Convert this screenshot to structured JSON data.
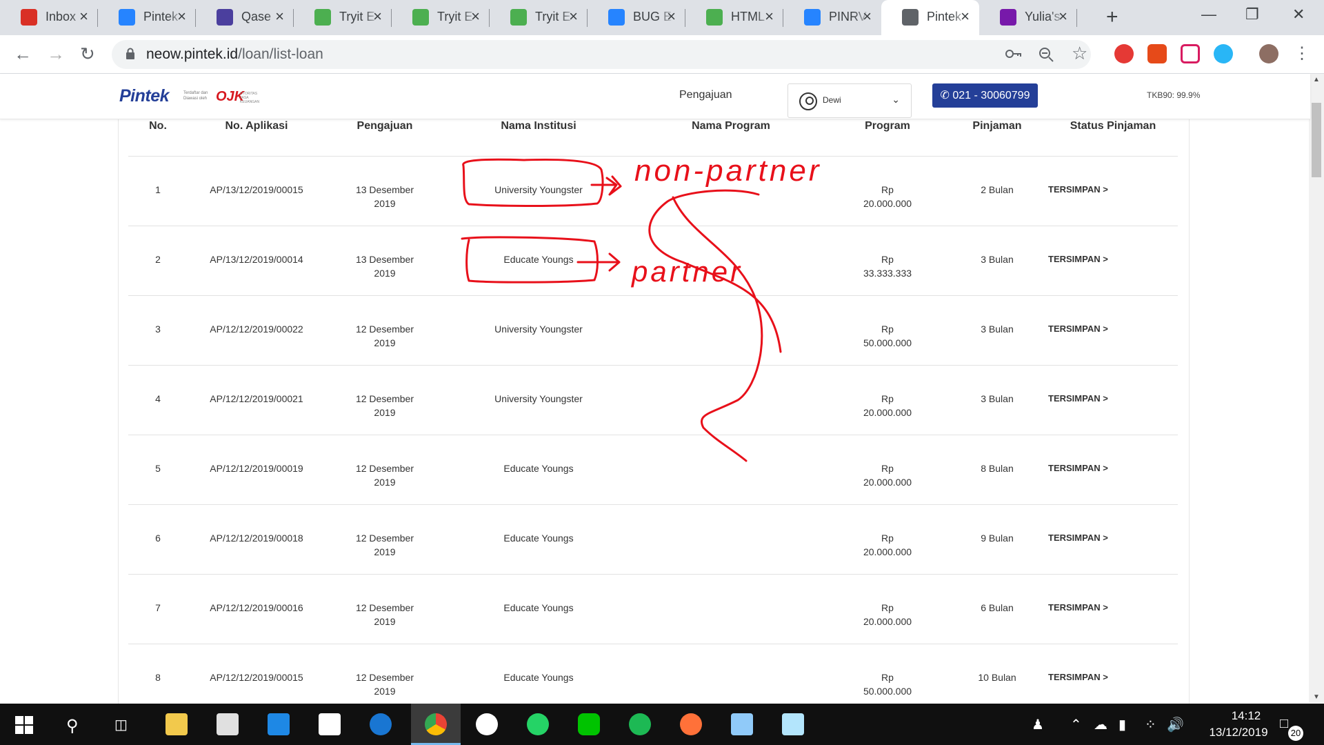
{
  "browser": {
    "tabs": [
      {
        "title": "Inbox",
        "favicon": "gmail-icon",
        "color": "#d93025"
      },
      {
        "title": "Pintek",
        "favicon": "jira-icon",
        "color": "#2684ff"
      },
      {
        "title": "Qase",
        "favicon": "qase-icon",
        "color": "#4b3f9e"
      },
      {
        "title": "Tryit E",
        "favicon": "w3schools-icon",
        "color": "#4caf50"
      },
      {
        "title": "Tryit E",
        "favicon": "w3schools-icon",
        "color": "#4caf50"
      },
      {
        "title": "Tryit E",
        "favicon": "w3schools-icon",
        "color": "#4caf50"
      },
      {
        "title": "BUG E",
        "favicon": "jira-icon",
        "color": "#2684ff"
      },
      {
        "title": "HTML",
        "favicon": "w3schools-icon",
        "color": "#4caf50"
      },
      {
        "title": "PINRV",
        "favicon": "jira-icon",
        "color": "#2684ff"
      },
      {
        "title": "Pintek",
        "favicon": "globe-icon",
        "color": "#5f6368"
      },
      {
        "title": "Yulia's",
        "favicon": "onenote-icon",
        "color": "#7719aa"
      }
    ],
    "active_tab": 9,
    "url_host": "neow.pintek.id",
    "url_path": "/loan/list-loan"
  },
  "header": {
    "logo": "Pintek",
    "ojk_registered": "Terdaftar dan Diawasi oleh",
    "ojk_logo": "OJK",
    "ojk_sub": "OTORITAS JASA KEUANGAN",
    "nav_pengajuan": "Pengajuan",
    "user_name": "Dewi",
    "phone": "021 - 30060799",
    "tkb": "TKB90: 99.9%"
  },
  "table": {
    "columns": [
      "No.",
      "No. Aplikasi",
      "Pengajuan",
      "Nama Institusi",
      "Nama Program",
      "Program",
      "Pinjaman",
      "Status Pinjaman"
    ],
    "rows": [
      {
        "no": "1",
        "app": "AP/13/12/2019/00015",
        "date1": "13 Desember",
        "date2": "2019",
        "inst": "University Youngster",
        "prog": "",
        "cur": "Rp",
        "amt": "20.000.000",
        "tenor": "2 Bulan",
        "status": "TERSIMPAN >"
      },
      {
        "no": "2",
        "app": "AP/13/12/2019/00014",
        "date1": "13 Desember",
        "date2": "2019",
        "inst": "Educate Youngs",
        "prog": "",
        "cur": "Rp",
        "amt": "33.333.333",
        "tenor": "3 Bulan",
        "status": "TERSIMPAN >"
      },
      {
        "no": "3",
        "app": "AP/12/12/2019/00022",
        "date1": "12 Desember",
        "date2": "2019",
        "inst": "University Youngster",
        "prog": "",
        "cur": "Rp",
        "amt": "50.000.000",
        "tenor": "3 Bulan",
        "status": "TERSIMPAN >"
      },
      {
        "no": "4",
        "app": "AP/12/12/2019/00021",
        "date1": "12 Desember",
        "date2": "2019",
        "inst": "University Youngster",
        "prog": "",
        "cur": "Rp",
        "amt": "20.000.000",
        "tenor": "3 Bulan",
        "status": "TERSIMPAN >"
      },
      {
        "no": "5",
        "app": "AP/12/12/2019/00019",
        "date1": "12 Desember",
        "date2": "2019",
        "inst": "Educate Youngs",
        "prog": "",
        "cur": "Rp",
        "amt": "20.000.000",
        "tenor": "8 Bulan",
        "status": "TERSIMPAN >"
      },
      {
        "no": "6",
        "app": "AP/12/12/2019/00018",
        "date1": "12 Desember",
        "date2": "2019",
        "inst": "Educate Youngs",
        "prog": "",
        "cur": "Rp",
        "amt": "20.000.000",
        "tenor": "9 Bulan",
        "status": "TERSIMPAN >"
      },
      {
        "no": "7",
        "app": "AP/12/12/2019/00016",
        "date1": "12 Desember",
        "date2": "2019",
        "inst": "Educate Youngs",
        "prog": "",
        "cur": "Rp",
        "amt": "20.000.000",
        "tenor": "6 Bulan",
        "status": "TERSIMPAN >"
      },
      {
        "no": "8",
        "app": "AP/12/12/2019/00015",
        "date1": "12 Desember",
        "date2": "2019",
        "inst": "Educate Youngs",
        "prog": "",
        "cur": "Rp",
        "amt": "50.000.000",
        "tenor": "10 Bulan",
        "status": "TERSIMPAN >"
      }
    ]
  },
  "annotations": {
    "label_top": "non-partner",
    "label_bottom": "partner",
    "color": "#e8101a"
  },
  "taskbar": {
    "time": "14:12",
    "date": "13/12/2019",
    "notifications": "20"
  }
}
